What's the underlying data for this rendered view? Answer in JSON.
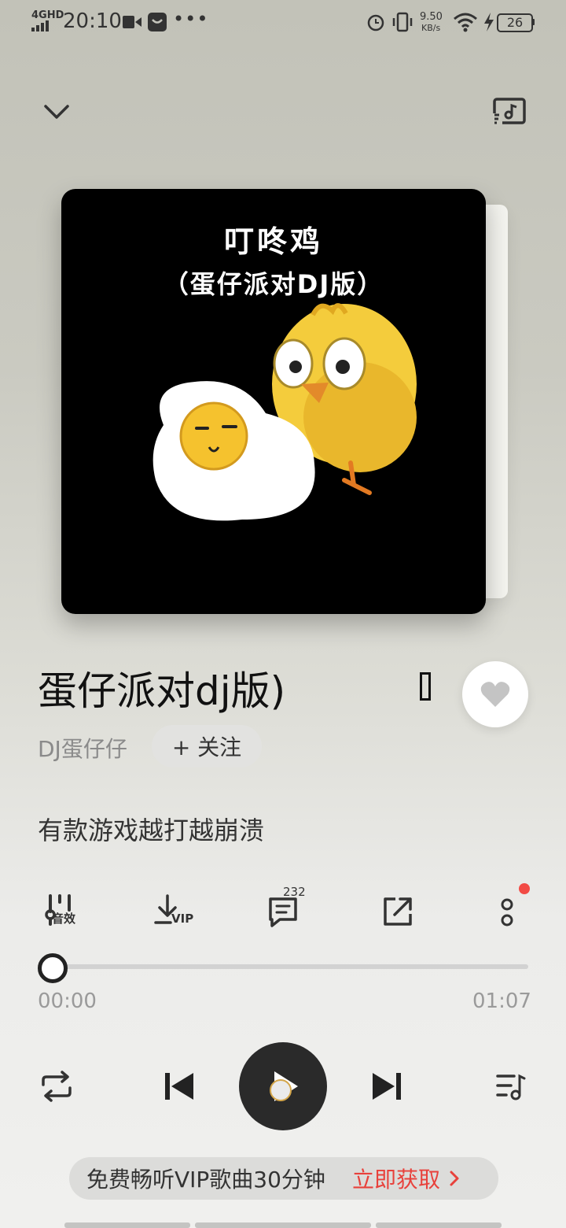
{
  "status_bar": {
    "network": "4GHD",
    "time": "20:10",
    "speed_value": "9.50",
    "speed_unit": "KB/s",
    "battery": "26"
  },
  "album": {
    "title_line1": "叮咚鸡",
    "title_line2": "（蛋仔派对DJ版）"
  },
  "song": {
    "title": "蛋仔派对dj版)",
    "artist": "DJ蛋仔仔",
    "follow_label": "+ 关注",
    "lyric": "有款游戏越打越崩溃"
  },
  "tools": {
    "effects_label": "音效",
    "download_label": "VIP",
    "comment_count": "232"
  },
  "progress": {
    "current": "00:00",
    "total": "01:07",
    "fraction": 0.0
  },
  "vip_banner": {
    "text": "免费畅听VIP歌曲30分钟",
    "action": "立即获取",
    "action_color": "#e8413b"
  },
  "icons": [
    "chevron-down-icon",
    "cast-icon",
    "heart-icon",
    "equalizer-icon",
    "download-icon",
    "comment-icon",
    "share-icon",
    "more-icon",
    "repeat-icon",
    "previous-icon",
    "play-icon",
    "next-icon",
    "playlist-icon"
  ]
}
